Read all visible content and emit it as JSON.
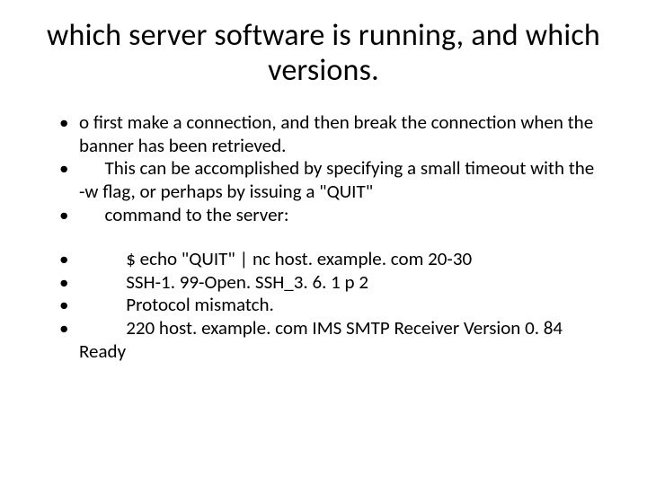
{
  "title": "which server software is running, and which versions.",
  "group1": [
    "o first make a connection, and then break the connection when the banner has been retrieved.",
    "      This can be accomplished by specifying a small timeout with the -w flag, or perhaps by issuing a \"QUIT\"",
    "      command to the server:"
  ],
  "group2": [
    "           $ echo \"QUIT\" | nc host. example. com 20-30",
    "           SSH-1. 99-Open. SSH_3. 6. 1 p 2",
    "           Protocol mismatch.",
    "           220 host. example. com IMS SMTP Receiver Version 0. 84 Ready"
  ]
}
